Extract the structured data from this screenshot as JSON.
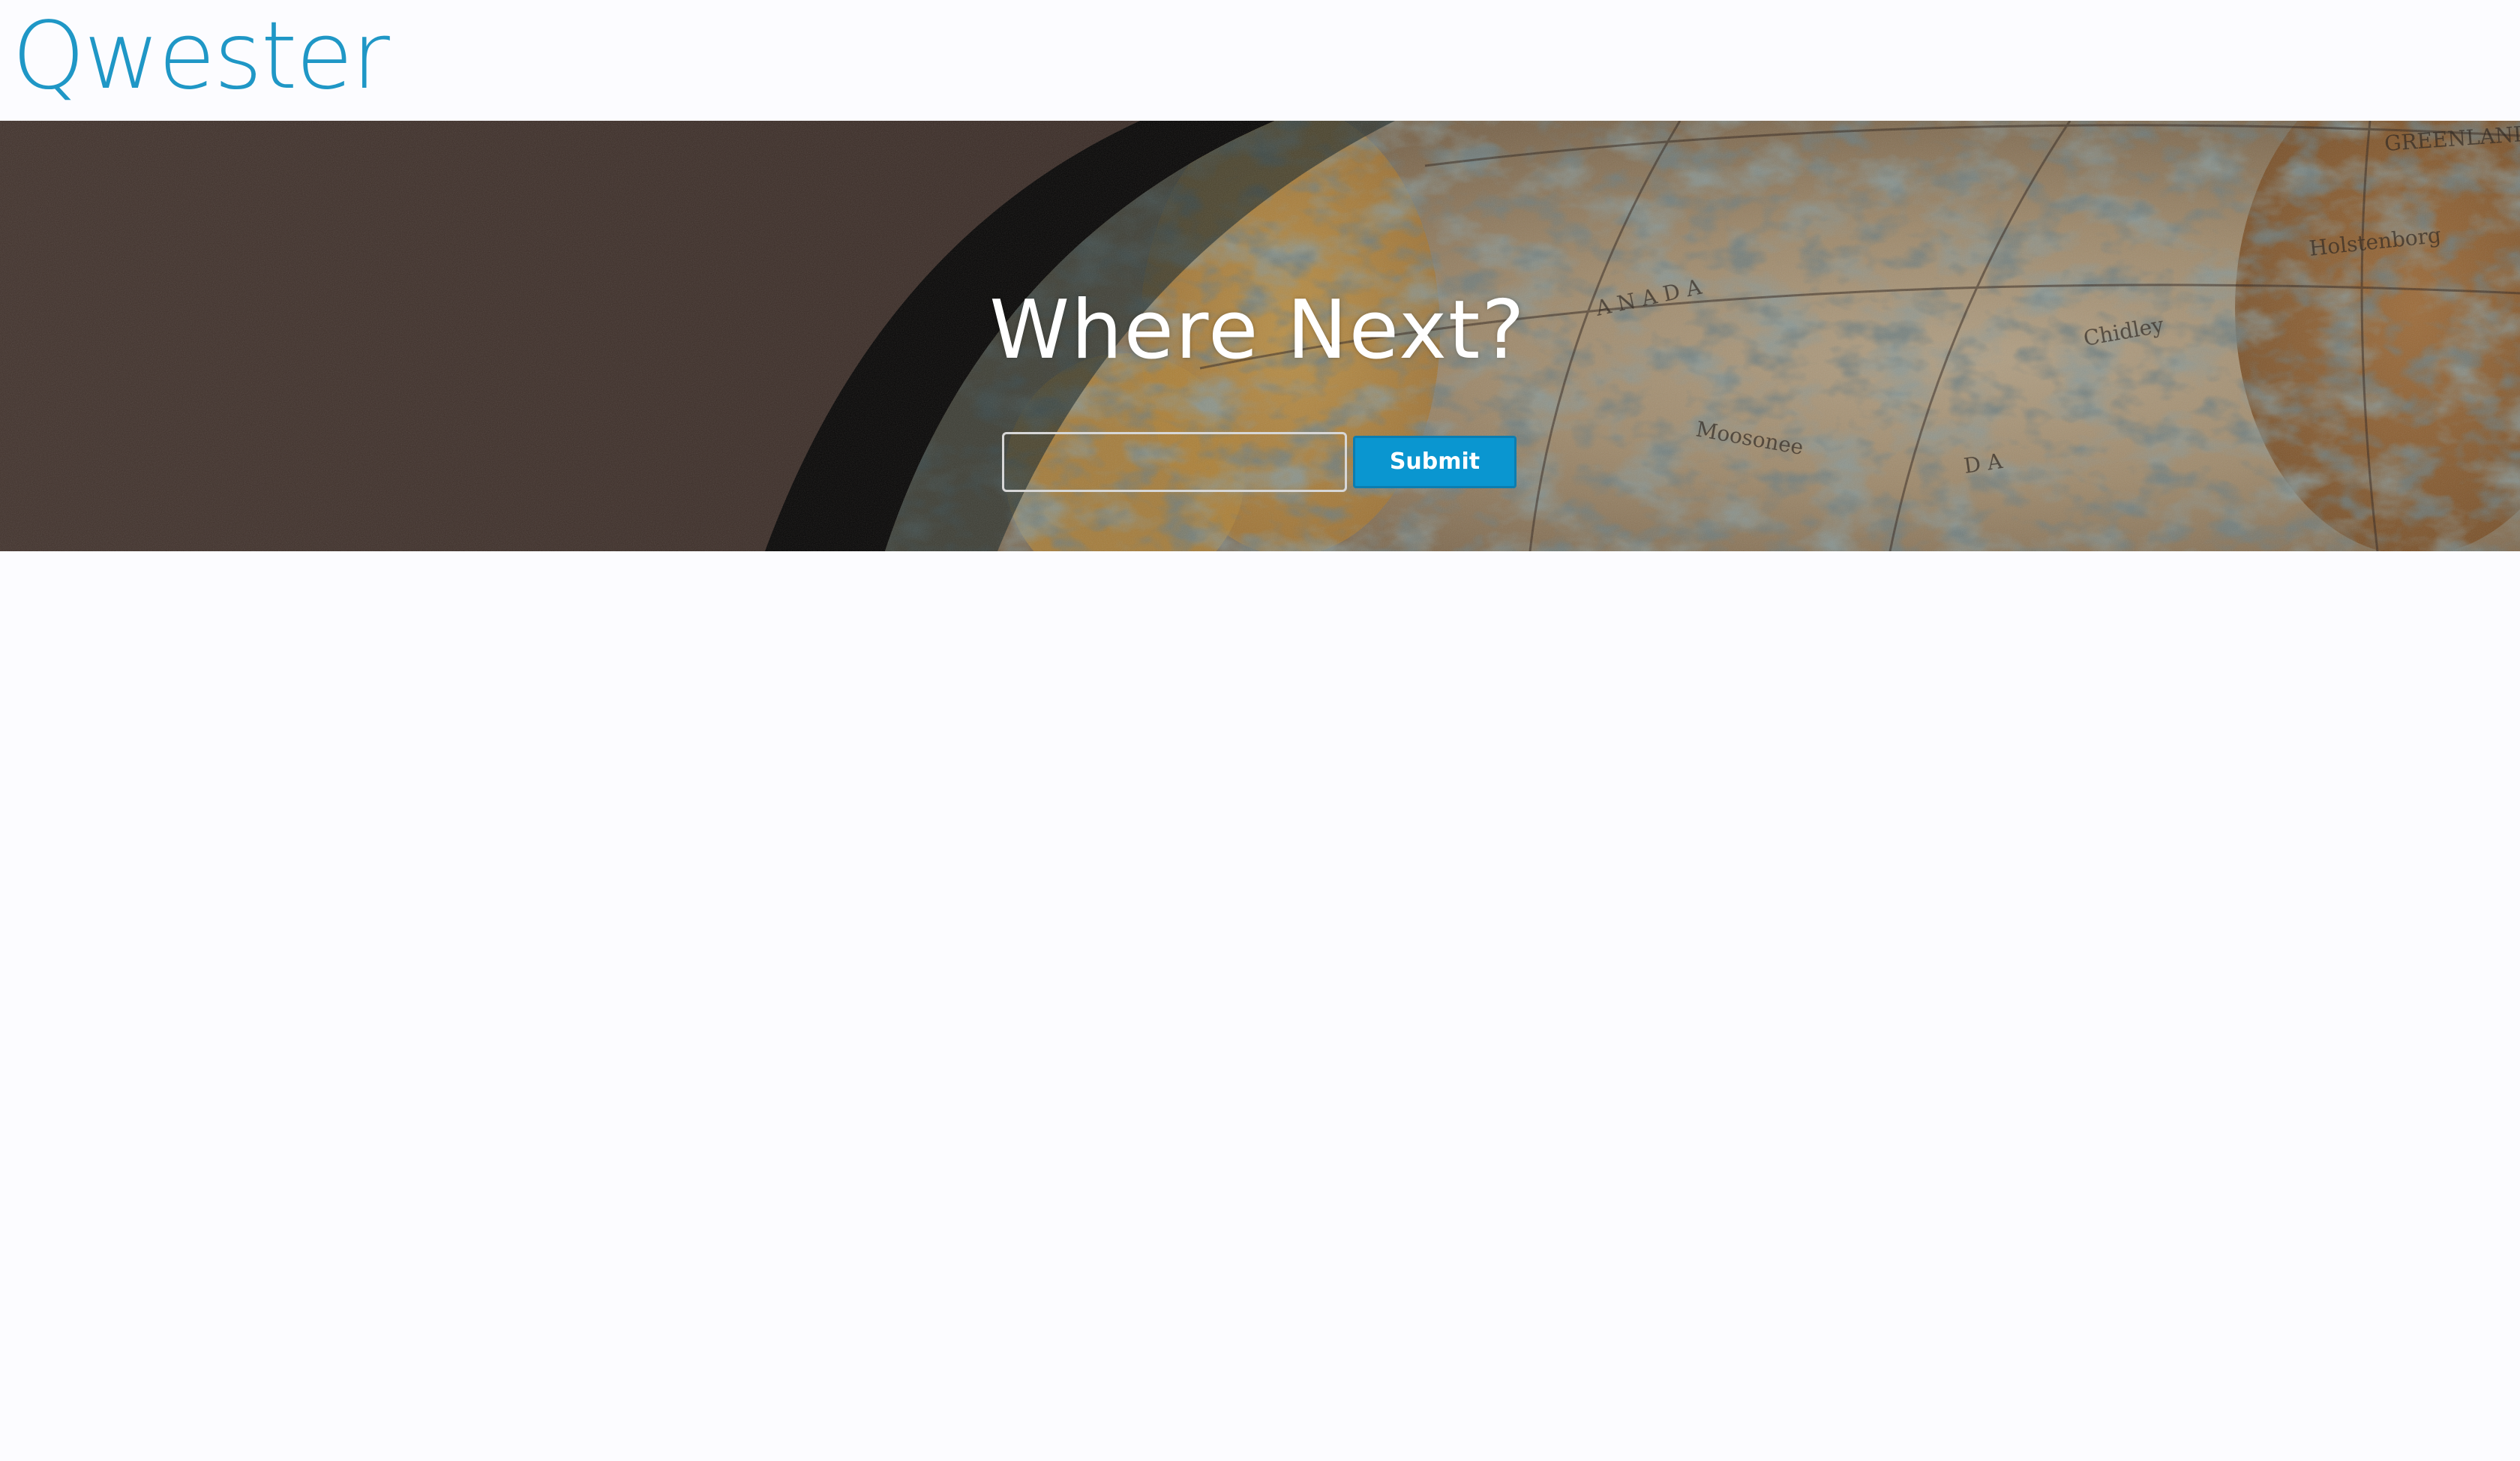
{
  "header": {
    "logo_text": "Qwester"
  },
  "hero": {
    "title": "Where Next?",
    "background_image": "globe-map-photo"
  },
  "search": {
    "value": "",
    "placeholder": ""
  },
  "submit": {
    "label": "Submit"
  },
  "colors": {
    "brand": "#1f97c6",
    "button": "#0a96d0",
    "page_background": "#fcfcff"
  }
}
